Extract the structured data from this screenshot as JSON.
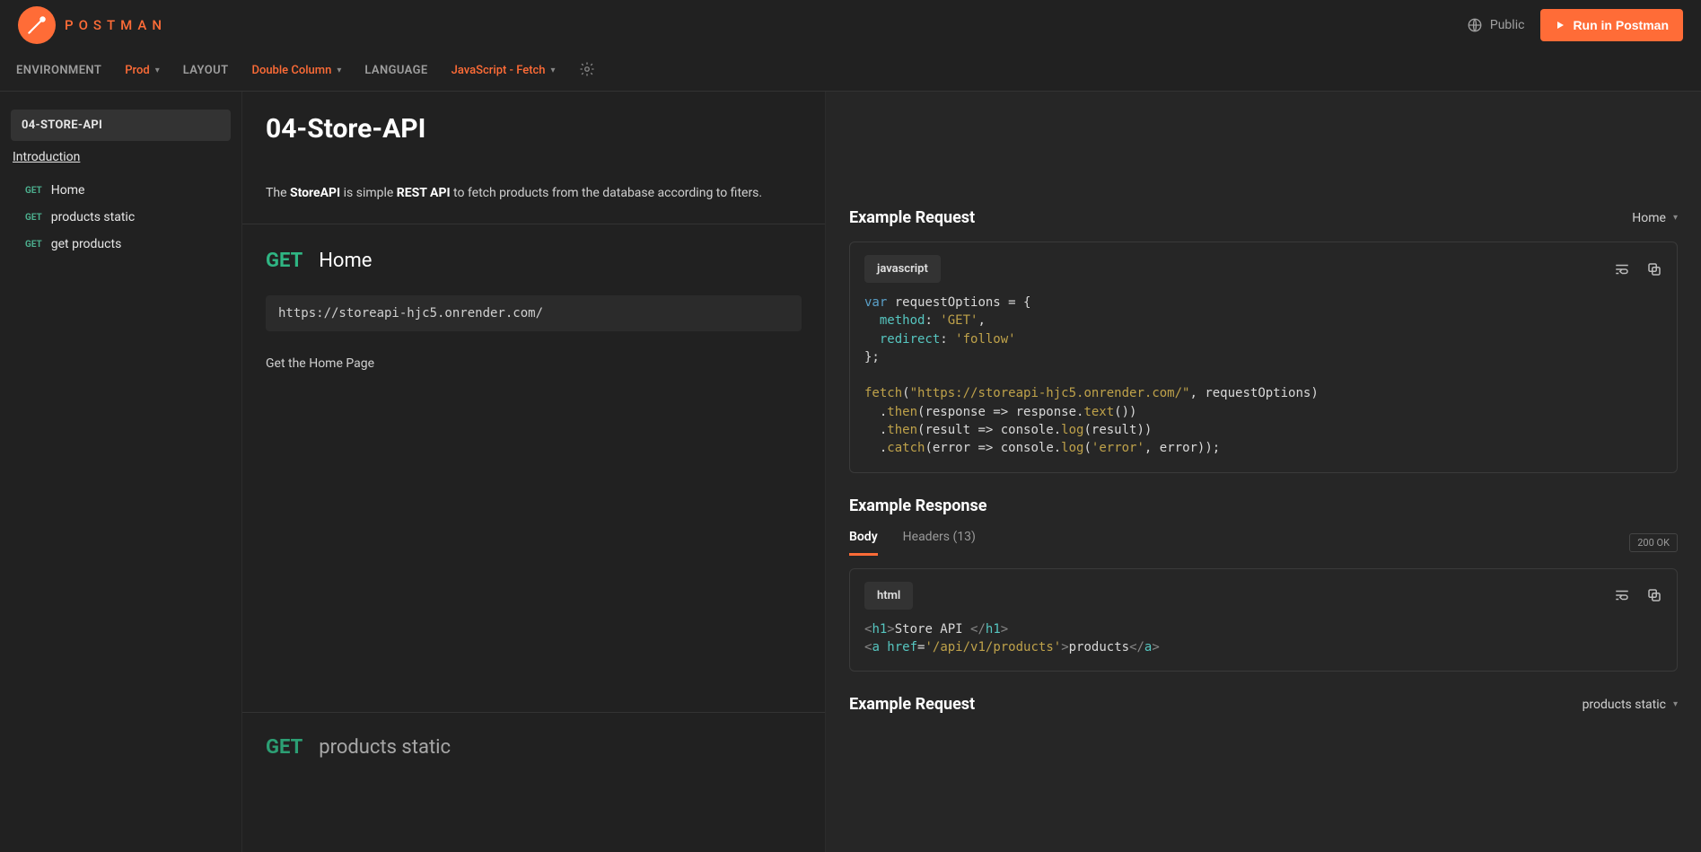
{
  "brand": {
    "name": "POSTMAN",
    "public": "Public",
    "run": "Run in Postman"
  },
  "toolbar": {
    "env_label": "ENVIRONMENT",
    "env_value": "Prod",
    "layout_label": "LAYOUT",
    "layout_value": "Double Column",
    "lang_label": "LANGUAGE",
    "lang_value": "JavaScript - Fetch"
  },
  "sidebar": {
    "title": "04-STORE-API",
    "intro": "Introduction",
    "items": [
      {
        "method": "GET",
        "label": "Home"
      },
      {
        "method": "GET",
        "label": "products static"
      },
      {
        "method": "GET",
        "label": "get products"
      }
    ]
  },
  "main": {
    "title": "04-Store-API",
    "desc_pre": "The ",
    "desc_b1": "StoreAPI",
    "desc_mid": " is simple ",
    "desc_b2": "REST API",
    "desc_post": " to fetch products from the database according to fiters.",
    "ep1": {
      "method": "GET",
      "name": "Home",
      "url": "https://storeapi-hjc5.onrender.com/",
      "body": "Get the Home Page"
    },
    "ep2": {
      "method": "GET",
      "name": "products static"
    }
  },
  "right": {
    "ex_req": "Example Request",
    "ex_res": "Example Response",
    "sel1": "Home",
    "sel2": "products static",
    "lang_js": "javascript",
    "lang_html": "html",
    "tabs": {
      "body": "Body",
      "headers": "Headers (13)"
    },
    "status": "200 OK",
    "code_js": {
      "l1_var": "var",
      "l1_rest": " requestOptions = {",
      "l2_key": "method",
      "l2_colon": ": ",
      "l2_val": "'GET'",
      "l2_comma": ",",
      "l3_key": "redirect",
      "l3_colon": ": ",
      "l3_val": "'follow'",
      "l4": "};",
      "l6_fetch": "fetch",
      "l6_open": "(",
      "l6_url": "\"https://storeapi-hjc5.onrender.com/\"",
      "l6_rest": ", requestOptions)",
      "l7_pre": "  .",
      "l7_then": "then",
      "l7_rest": "(response => response.",
      "l7_text": "text",
      "l7_end": "())",
      "l8_pre": "  .",
      "l8_then": "then",
      "l8_rest": "(result => console.",
      "l8_log": "log",
      "l8_end": "(result))",
      "l9_pre": "  .",
      "l9_catch": "catch",
      "l9_rest": "(error => console.",
      "l9_log": "log",
      "l9_open": "(",
      "l9_err": "'error'",
      "l9_end": ", error));"
    },
    "code_html": {
      "h1_open_a": "<",
      "h1_open_t": "h1",
      "h1_open_b": ">",
      "h1_text": "Store API ",
      "h1_close_a": "</",
      "h1_close_t": "h1",
      "h1_close_b": ">",
      "a_open_a": "<",
      "a_open_t": "a",
      "a_attr_k": " href",
      "a_attr_eq": "=",
      "a_attr_v": "'/api/v1/products'",
      "a_open_b": ">",
      "a_text": "products",
      "a_close_a": "</",
      "a_close_t": "a",
      "a_close_b": ">"
    }
  }
}
